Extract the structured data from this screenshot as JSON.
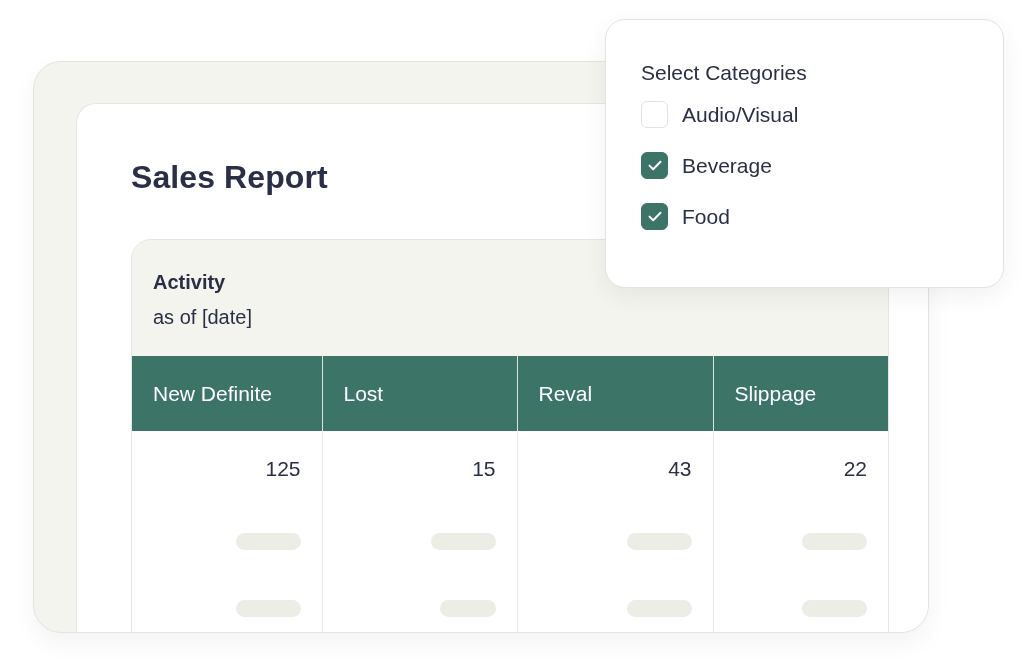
{
  "report": {
    "title": "Sales Report",
    "activity": {
      "title": "Activity",
      "subtitle": "as of [date]"
    },
    "table": {
      "columns": [
        "New Definite",
        "Lost",
        "Reval",
        "Slippage"
      ],
      "rows": [
        {
          "kind": "values",
          "cells": [
            "125",
            "15",
            "43",
            "22"
          ]
        },
        {
          "kind": "placeholder"
        },
        {
          "kind": "placeholder"
        }
      ]
    }
  },
  "category_filter": {
    "title": "Select Categories",
    "options": [
      {
        "label": "Audio/Visual",
        "checked": false
      },
      {
        "label": "Beverage",
        "checked": true
      },
      {
        "label": "Food",
        "checked": true
      }
    ]
  }
}
